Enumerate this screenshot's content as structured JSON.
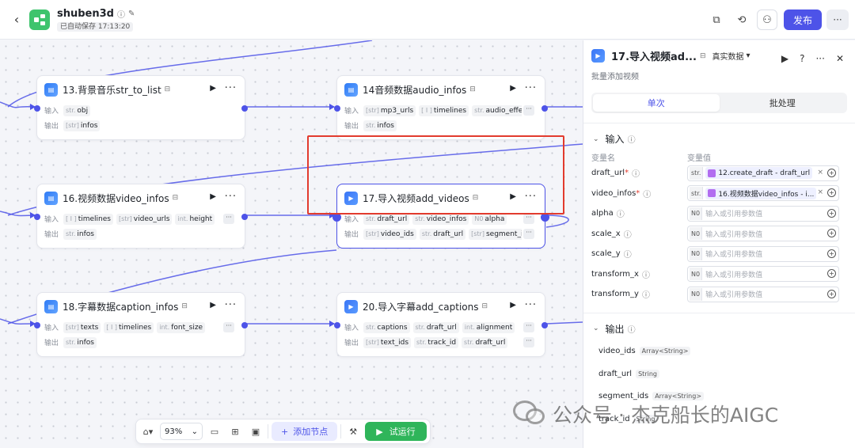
{
  "topbar": {
    "back": "‹",
    "app_name": "shuben3d",
    "autosave": "已自动保存 17:13:20",
    "publish": "发布"
  },
  "nodes": {
    "n13": {
      "title": "13.背景音乐str_to_list",
      "in_label": "输入",
      "out_label": "输出",
      "inputs": [
        {
          "t": "str.",
          "n": "obj"
        }
      ],
      "outputs": [
        {
          "t": "[str]",
          "n": "infos"
        }
      ]
    },
    "n14": {
      "title": "14音频数据audio_infos",
      "in_label": "输入",
      "out_label": "输出",
      "inputs": [
        {
          "t": "[str]",
          "n": "mp3_urls"
        },
        {
          "t": "[ I ]",
          "n": "timelines"
        },
        {
          "t": "str.",
          "n": "audio_effect"
        }
      ],
      "outputs": [
        {
          "t": "str.",
          "n": "infos"
        }
      ]
    },
    "n16": {
      "title": "16.视频数据video_infos",
      "in_label": "输入",
      "out_label": "输出",
      "inputs": [
        {
          "t": "[ I ]",
          "n": "timelines"
        },
        {
          "t": "[str]",
          "n": "video_urls"
        },
        {
          "t": "int.",
          "n": "height"
        }
      ],
      "outputs": [
        {
          "t": "str.",
          "n": "infos"
        }
      ]
    },
    "n17": {
      "title": "17.导入视频add_videos",
      "in_label": "输入",
      "out_label": "输出",
      "inputs": [
        {
          "t": "str.",
          "n": "draft_url"
        },
        {
          "t": "str.",
          "n": "video_infos"
        },
        {
          "t": "N0",
          "n": "alpha"
        }
      ],
      "outputs": [
        {
          "t": "[str]",
          "n": "video_ids"
        },
        {
          "t": "str.",
          "n": "draft_url"
        },
        {
          "t": "[str]",
          "n": "segment_ids"
        }
      ]
    },
    "n18": {
      "title": "18.字幕数据caption_infos",
      "in_label": "输入",
      "out_label": "输出",
      "inputs": [
        {
          "t": "[str]",
          "n": "texts"
        },
        {
          "t": "[ I ]",
          "n": "timelines"
        },
        {
          "t": "int.",
          "n": "font_size"
        }
      ],
      "outputs": [
        {
          "t": "str.",
          "n": "infos"
        }
      ]
    },
    "n20": {
      "title": "20.导入字幕add_captions",
      "in_label": "输入",
      "out_label": "输出",
      "inputs": [
        {
          "t": "str.",
          "n": "captions"
        },
        {
          "t": "str.",
          "n": "draft_url"
        },
        {
          "t": "int.",
          "n": "alignment"
        }
      ],
      "outputs": [
        {
          "t": "[str]",
          "n": "text_ids"
        },
        {
          "t": "str.",
          "n": "track_id"
        },
        {
          "t": "str.",
          "n": "draft_url"
        }
      ]
    }
  },
  "toolbar": {
    "zoom": "93%",
    "add_node": "添加节点",
    "test_run": "试运行"
  },
  "panel": {
    "title": "17.导入视频ad...",
    "mode": "真实数据",
    "desc": "批量添加视频",
    "tabs": [
      "单次",
      "批处理"
    ],
    "input_section": "输入",
    "col_name": "变量名",
    "col_value": "变量值",
    "placeholder": "输入或引用参数值",
    "params": [
      {
        "name": "draft_url",
        "required": true,
        "type": "str.",
        "ref": "12.create_draft - draft_url"
      },
      {
        "name": "video_infos",
        "required": true,
        "type": "str.",
        "ref": "16.视频数据video_infos - i..."
      },
      {
        "name": "alpha",
        "required": false,
        "type": "N0",
        "ref": ""
      },
      {
        "name": "scale_x",
        "required": false,
        "type": "N0",
        "ref": ""
      },
      {
        "name": "scale_y",
        "required": false,
        "type": "N0",
        "ref": ""
      },
      {
        "name": "transform_x",
        "required": false,
        "type": "N0",
        "ref": ""
      },
      {
        "name": "transform_y",
        "required": false,
        "type": "N0",
        "ref": ""
      }
    ],
    "output_section": "输出",
    "outputs": [
      {
        "name": "video_ids",
        "type": "Array<String>"
      },
      {
        "name": "draft_url",
        "type": "String"
      },
      {
        "name": "segment_ids",
        "type": "Array<String>"
      },
      {
        "name": "track_id",
        "type": "String"
      }
    ]
  },
  "watermark": "公众号 · 杰克船长的AIGC",
  "colors": {
    "accent": "#4d53e8",
    "run": "#2fb55a",
    "highlight": "#e23b2e",
    "logo": "#3ec46d"
  }
}
